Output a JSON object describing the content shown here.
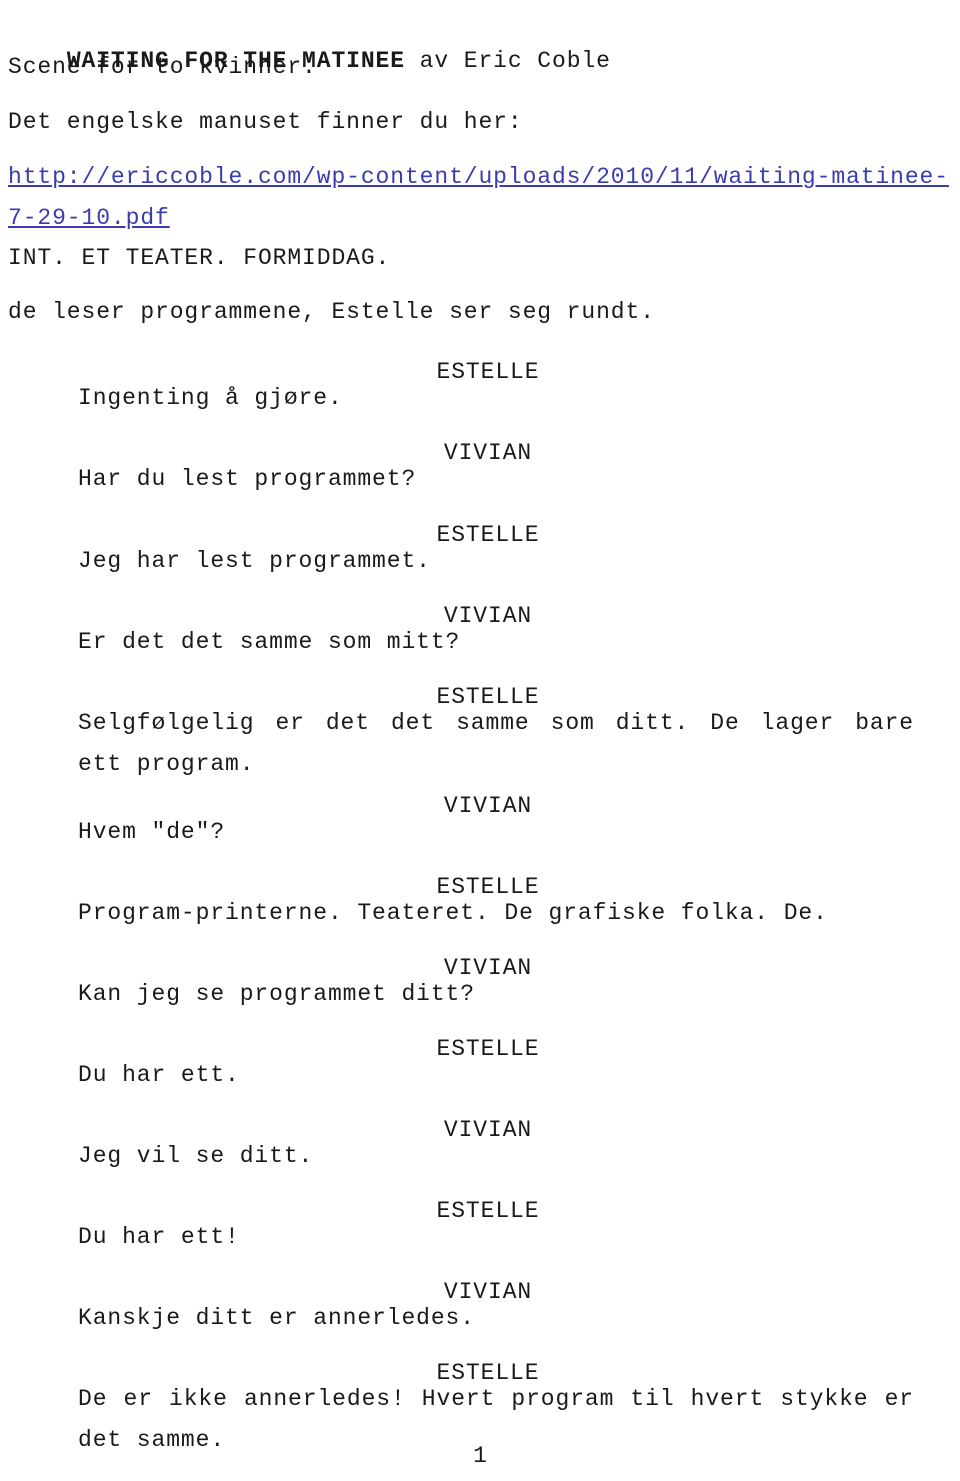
{
  "document": {
    "title_main": "WAITING FOR THE MATINEE",
    "title_byline": " av Eric Coble",
    "subtitle": "Scene for to kvinner.",
    "source_intro": "Det engelske manuset finner du her:",
    "source_url": "http://ericcoble.com/wp-content/uploads/2010/11/waiting-matinee-7-29-10.pdf",
    "scene_heading": "INT. ET TEATER. FORMIDDAG.",
    "stage_direction": "de leser programmene, Estelle ser seg rundt.",
    "page_number": "1",
    "link_color": "#3b3bb0",
    "text_color": "#1a1a1a"
  },
  "characters": {
    "estelle": "ESTELLE",
    "vivian": "VIVIAN"
  },
  "script": [
    {
      "cue": "ESTELLE",
      "line": "Ingenting å gjøre."
    },
    {
      "cue": "VIVIAN",
      "line": "Har du lest programmet?"
    },
    {
      "cue": "ESTELLE",
      "line": "Jeg har lest programmet."
    },
    {
      "cue": "VIVIAN",
      "line": "Er det det samme som mitt?"
    },
    {
      "cue": "ESTELLE",
      "line": "Selgfølgelig er det det samme som ditt. De lager bare ett program."
    },
    {
      "cue": "VIVIAN",
      "line": "Hvem \"de\"?"
    },
    {
      "cue": "ESTELLE",
      "line": "Program-printerne. Teateret. De grafiske folka. De."
    },
    {
      "cue": "VIVIAN",
      "line": "Kan jeg se programmet ditt?"
    },
    {
      "cue": "ESTELLE",
      "line": "Du har ett."
    },
    {
      "cue": "VIVIAN",
      "line": "Jeg vil se ditt."
    },
    {
      "cue": "ESTELLE",
      "line": "Du har ett!"
    },
    {
      "cue": "VIVIAN",
      "line": "Kanskje ditt er annerledes."
    },
    {
      "cue": "ESTELLE",
      "line": "De er ikke annerledes! Hvert program til hvert stykke er det samme."
    }
  ]
}
